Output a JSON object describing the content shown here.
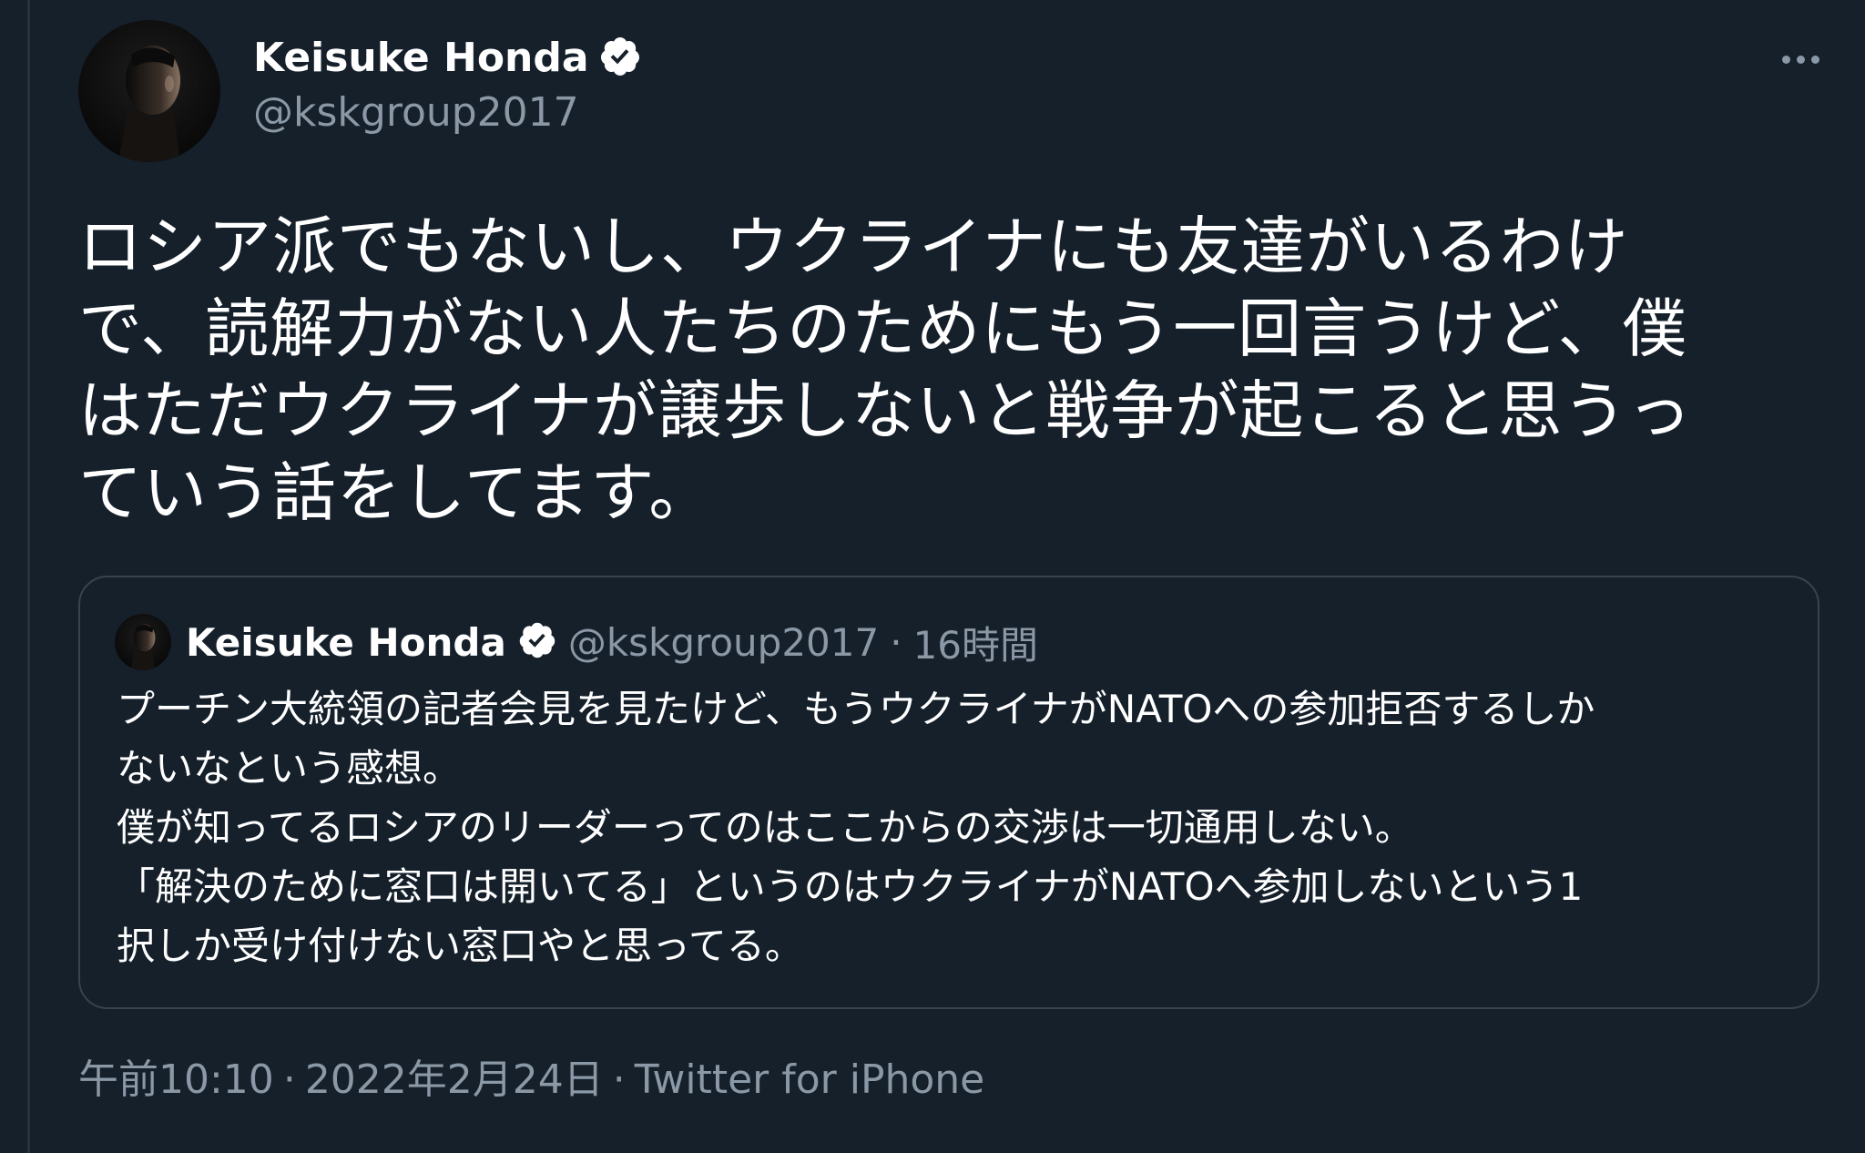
{
  "colors": {
    "background": "#15202b",
    "text": "#ffffff",
    "secondary_text": "#8b98a5",
    "border": "#38444d",
    "verified_badge": "#ffffff"
  },
  "header": {
    "display_name": "Keisuke Honda",
    "handle": "@kskgroup2017",
    "verified_icon": "verified-badge-icon",
    "more_icon": "more-horizontal-icon"
  },
  "tweet": {
    "lines": [
      "ロシア派でもないし、ウクライナにも友達がいるわけ",
      "で、読解力がない人たちのためにもう一回言うけど、僕",
      "はただウクライナが譲歩しないと戦争が起こると思うっ",
      "ていう話をしてます。"
    ]
  },
  "quoted_tweet": {
    "display_name": "Keisuke Honda",
    "handle": "@kskgroup2017",
    "separator": "·",
    "time": "16時間",
    "lines": [
      "プーチン大統領の記者会見を見たけど、もうウクライナがNATOへの参加拒否するしか",
      "ないなという感想。",
      "僕が知ってるロシアのリーダーってのはここからの交渉は一切通用しない。",
      "「解決のために窓口は開いてる」というのはウクライナがNATOへ参加しないという1",
      "択しか受け付けない窓口やと思ってる。"
    ]
  },
  "meta": {
    "time": "午前10:10",
    "separator": "·",
    "date": "2022年2月24日",
    "source": "Twitter for iPhone"
  }
}
